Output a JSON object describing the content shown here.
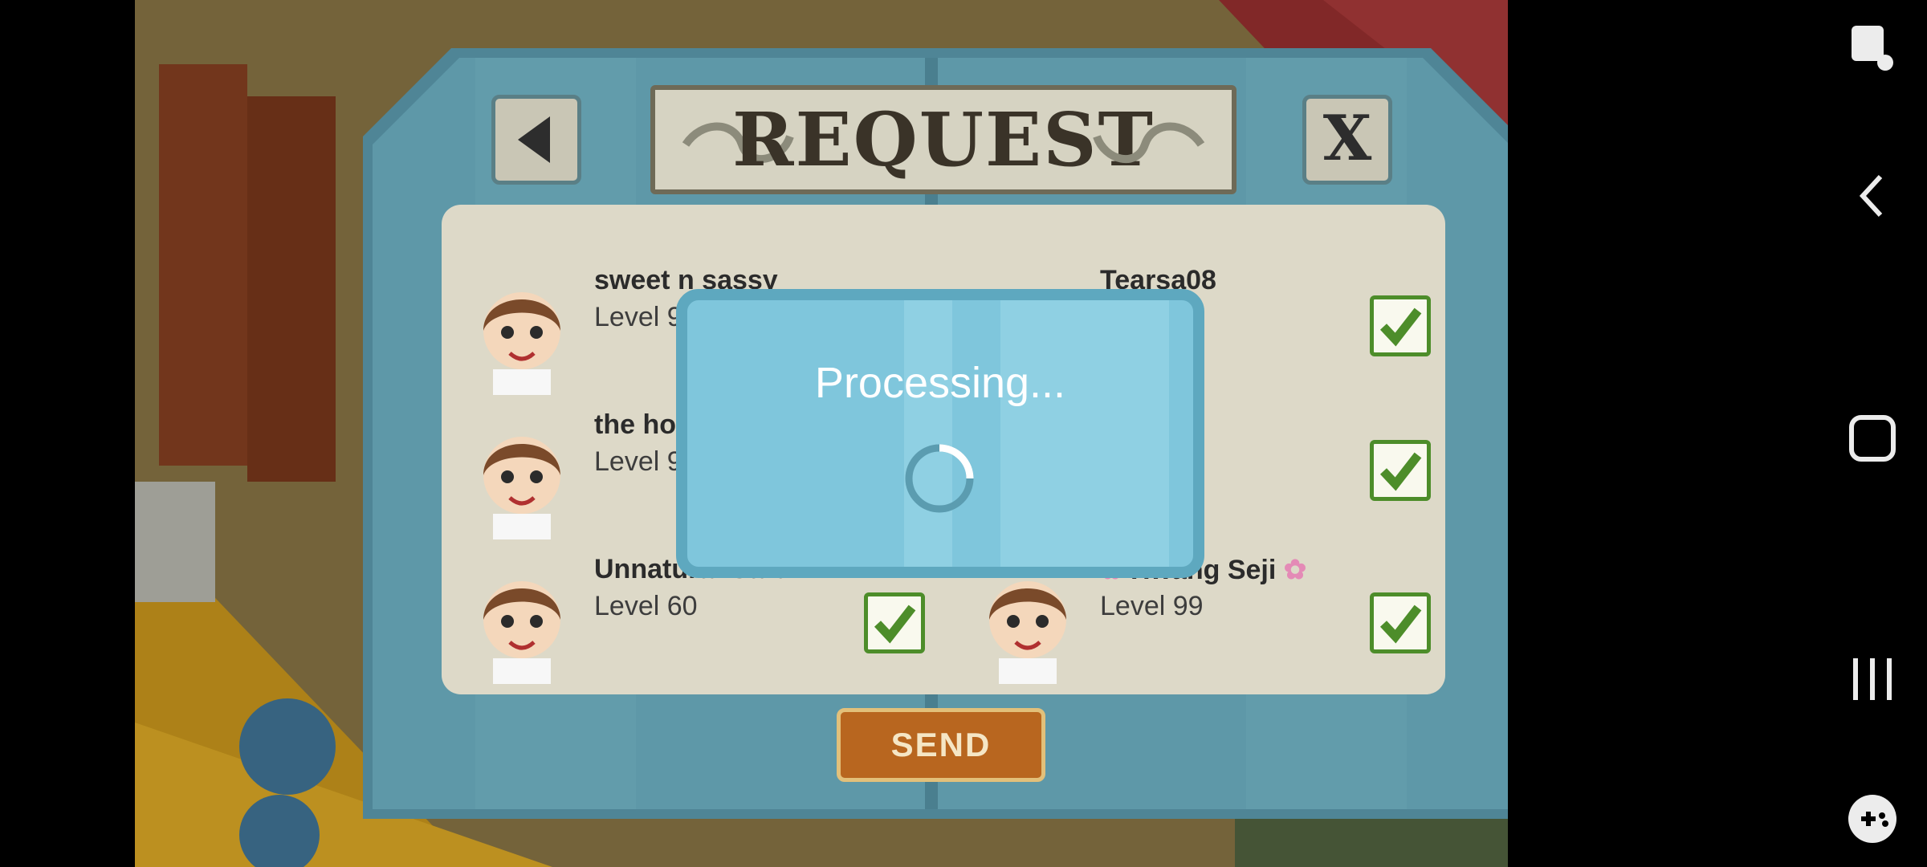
{
  "dialog": {
    "title": "REQUEST",
    "back_icon": "triangle-left-icon",
    "close_label": "X",
    "send_label": "SEND"
  },
  "friends": [
    {
      "name": "sweet n sassy",
      "level": "Level 99",
      "checked": true
    },
    {
      "name": "Tearsa08",
      "level": "",
      "checked": true
    },
    {
      "name": "the hot",
      "level": "Level 92",
      "checked": false
    },
    {
      "name": "",
      "level": "",
      "checked": true
    },
    {
      "name": "Unnatural Cafe",
      "level": "Level 60",
      "checked": true
    },
    {
      "name": "Hwang Seji",
      "level": "Level 99",
      "checked": true
    }
  ],
  "processing": {
    "label": "Processing..."
  },
  "system_nav": {
    "icons": [
      "screenshot-touch-icon",
      "back-chevron-icon",
      "home-square-icon",
      "recents-lines-icon",
      "game-controller-icon"
    ]
  },
  "colors": {
    "panel": "#5e98a8",
    "overlay": "#7fc6dc",
    "send": "#b8661f",
    "check": "#4d8d2a"
  }
}
